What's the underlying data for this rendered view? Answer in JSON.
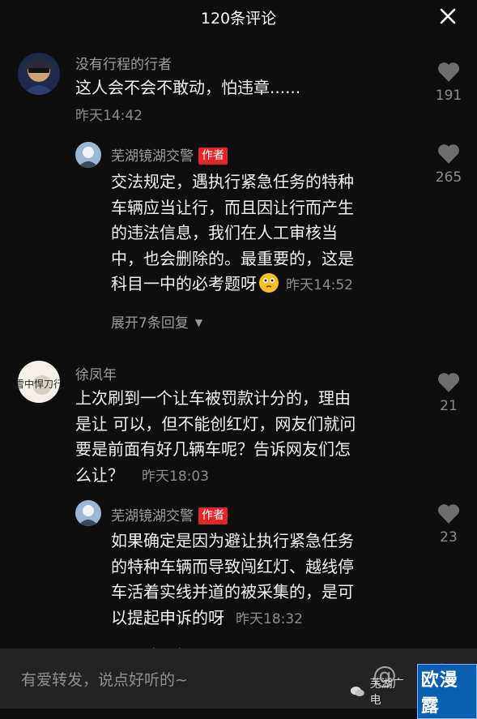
{
  "header": {
    "title": "120条评论"
  },
  "comments": [
    {
      "username": "没有行程的行者",
      "lines": [
        "这人会不会不敢动，怕违章......"
      ],
      "time": "昨天14:42",
      "likes": "191"
    },
    {
      "username": "芜湖镜湖交警",
      "badge": "作者",
      "lines": [
        "交法规定，遇执行紧急任务的特种",
        "车辆应当让行，而且因让行而产生",
        "的违法信息，我们在人工审核当",
        "中，也会删除的。最重要的，这是",
        "科目一中的必考题呀"
      ],
      "time": "昨天14:52",
      "likes": "265"
    },
    {
      "username": "徐凤年",
      "avatar_text": "雪中悍刀行",
      "lines": [
        "上次刷到一个让车被罚款计分的，理由",
        "是让 可以，但不能创红灯，网友们就问",
        "要是前面有好几辆车呢？告诉网友们怎",
        "么让？"
      ],
      "time": "昨天18:03",
      "likes": "21"
    },
    {
      "username": "芜湖镜湖交警",
      "badge": "作者",
      "lines": [
        "如果确定是因为避让执行紧急任务",
        "的特种车辆而导致闯红灯、越线停",
        "车活着实线并道的被采集的，是可",
        "以提起申诉的呀"
      ],
      "time": "昨天18:32",
      "likes": "23"
    }
  ],
  "expand": {
    "label": "展开7条回复"
  },
  "input": {
    "placeholder": "有爱转发，说点好听的~"
  },
  "watermark": {
    "text": "芜湖广电",
    "logo": "欧漫露"
  },
  "colors": {
    "background": "#0e0e0e",
    "badge": "#e0262b",
    "input_bar": "#232323"
  }
}
